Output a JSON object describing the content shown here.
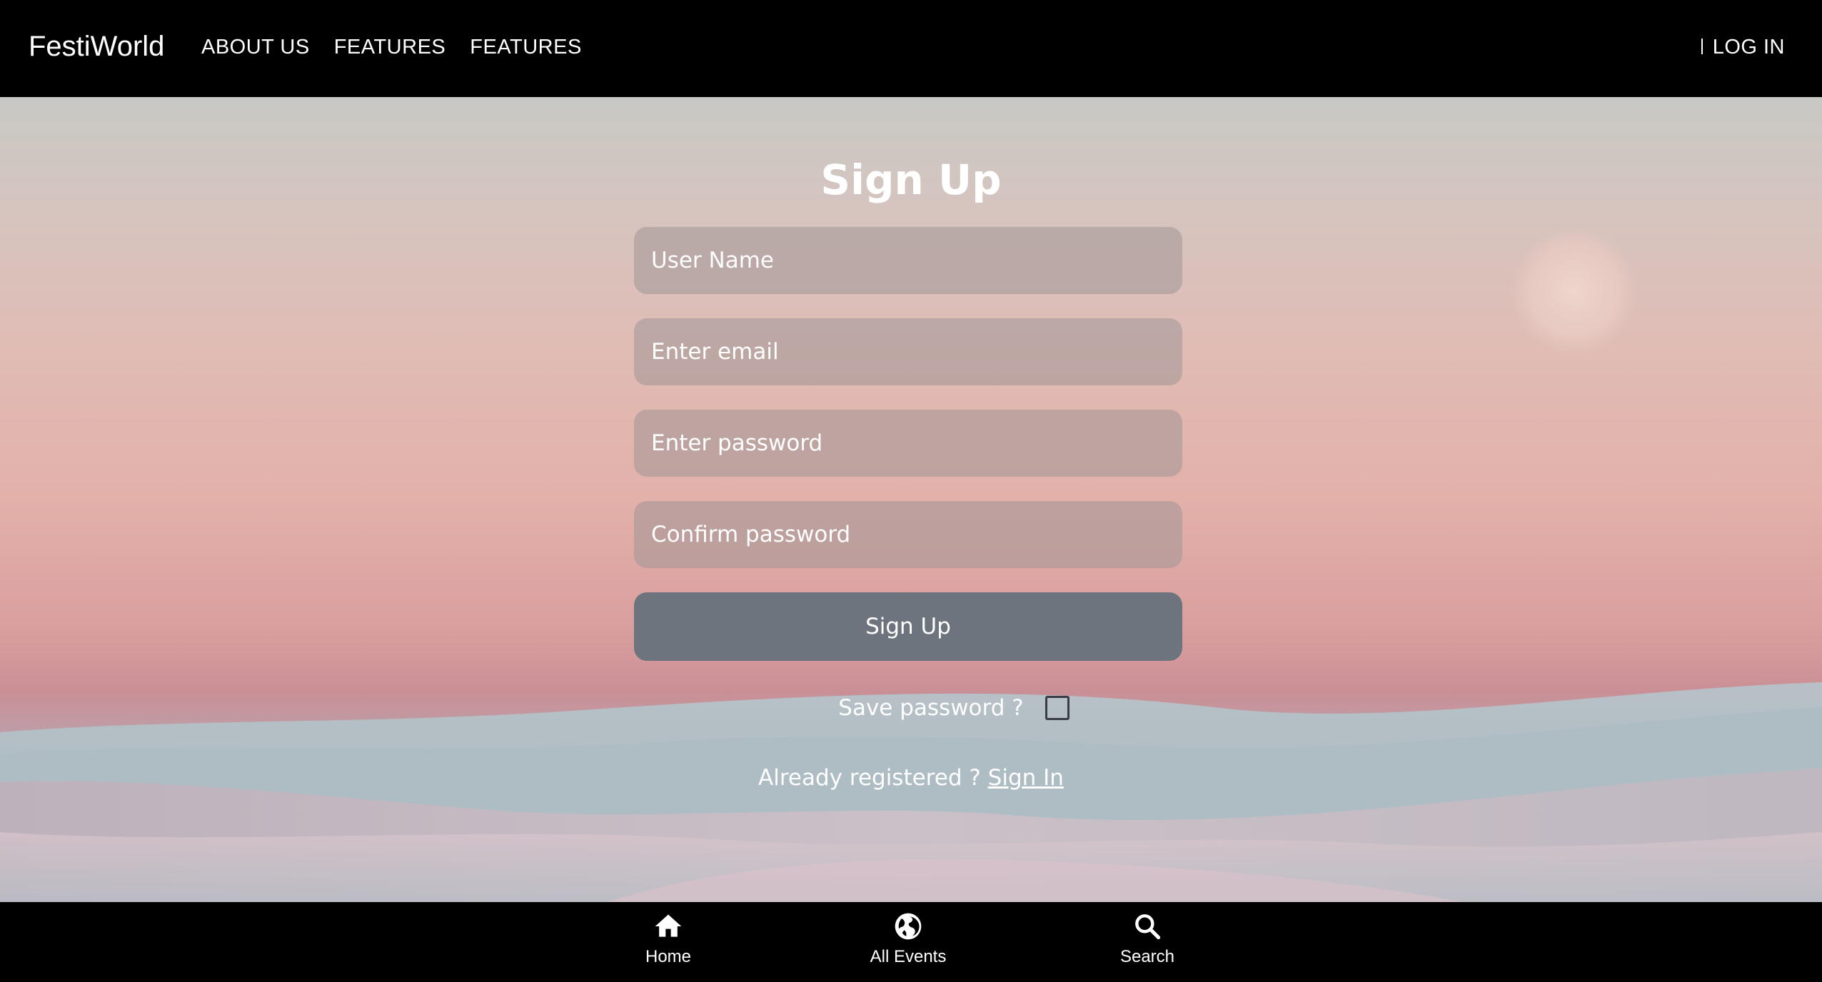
{
  "header": {
    "brand": "FestiWorld",
    "nav": [
      {
        "label": "ABOUT US"
      },
      {
        "label": "FEATURES"
      },
      {
        "label": "FEATURES"
      }
    ],
    "login_label": "LOG IN"
  },
  "form": {
    "title": "Sign Up",
    "fields": [
      {
        "placeholder": "User Name",
        "value": ""
      },
      {
        "placeholder": "Enter email",
        "value": ""
      },
      {
        "placeholder": "Enter password",
        "value": ""
      },
      {
        "placeholder": "Confirm password",
        "value": ""
      }
    ],
    "submit_label": "Sign Up",
    "save_password_label": "Save password ?",
    "save_password_checked": false,
    "already_registered_text": "Already registered ?",
    "sign_in_link": "Sign In"
  },
  "bottom_nav": {
    "items": [
      {
        "label": "Home",
        "icon": "home-icon"
      },
      {
        "label": "All Events",
        "icon": "globe-icon"
      },
      {
        "label": "Search",
        "icon": "search-icon"
      }
    ]
  },
  "colors": {
    "bar_background": "#000000",
    "button_background": "#6e747e",
    "field_background": "rgba(160,150,150,0.55)",
    "text": "#ffffff"
  }
}
